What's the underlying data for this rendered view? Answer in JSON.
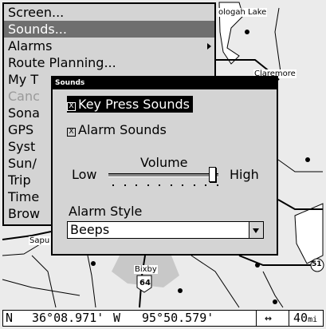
{
  "map": {
    "labels": {
      "oologah_lake": "ologah Lake",
      "claremore": "Claremore",
      "sapulpa": "Sapu",
      "bixby": "Bixby"
    },
    "shields": {
      "hwy_64": "64",
      "hwy_51": "51"
    }
  },
  "main_menu": {
    "items": [
      {
        "label": "Screen..."
      },
      {
        "label": "Sounds..."
      },
      {
        "label": "Alarms"
      },
      {
        "label": "Route Planning..."
      },
      {
        "label": "My T"
      },
      {
        "label": "Canc"
      },
      {
        "label": "Sona"
      },
      {
        "label": "GPS"
      },
      {
        "label": "Syst"
      },
      {
        "label": "Sun/"
      },
      {
        "label": "Trip"
      },
      {
        "label": "Time"
      },
      {
        "label": "Brow"
      }
    ],
    "selected_index": 1
  },
  "sounds_dialog": {
    "title": "Sounds",
    "key_press_sounds": {
      "label": "Key Press Sounds",
      "checked": true,
      "mark": "X"
    },
    "alarm_sounds": {
      "label": "Alarm Sounds",
      "checked": true,
      "mark": "X"
    },
    "volume": {
      "label": "Volume",
      "low_label": "Low",
      "high_label": "High",
      "level_fraction": 0.95
    },
    "alarm_style": {
      "label": "Alarm Style",
      "selected_value": "Beeps"
    }
  },
  "status_bar": {
    "lat_hemisphere": "N",
    "latitude": "36°08.971'",
    "lon_hemisphere": "W",
    "longitude": "95°50.579'",
    "zoom_icon": "double-arrow-icon",
    "zoom_value": "40",
    "zoom_unit": "mi"
  }
}
